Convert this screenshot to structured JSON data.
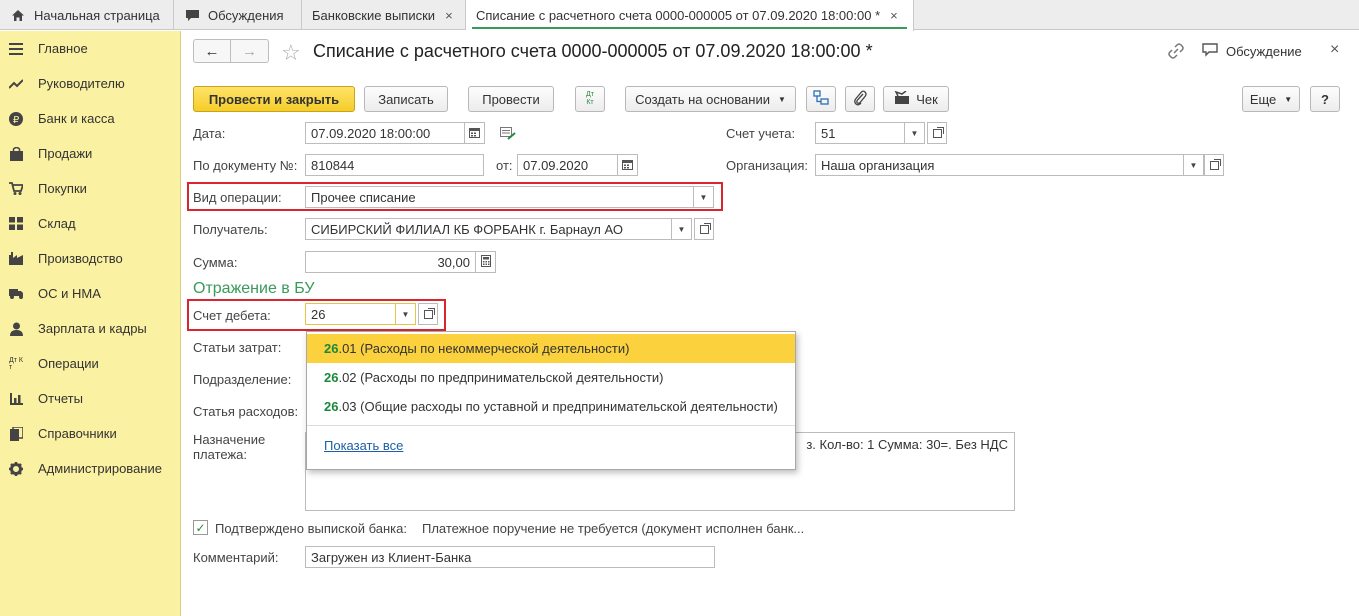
{
  "tabs": [
    {
      "label": "Начальная страница",
      "icon": "home-icon"
    },
    {
      "label": "Обсуждения",
      "icon": "chat-icon"
    },
    {
      "label": "Банковские выписки",
      "close": "×"
    },
    {
      "label": "Списание с расчетного счета 0000-000005 от 07.09.2020 18:00:00 *",
      "close": "×"
    }
  ],
  "sidebar": {
    "items": [
      {
        "label": "Главное",
        "icon": "menu-icon"
      },
      {
        "label": "Руководителю",
        "icon": "trend-icon"
      },
      {
        "label": "Банк и касса",
        "icon": "ruble-icon"
      },
      {
        "label": "Продажи",
        "icon": "bag-icon"
      },
      {
        "label": "Покупки",
        "icon": "cart-icon"
      },
      {
        "label": "Склад",
        "icon": "grid-icon"
      },
      {
        "label": "Производство",
        "icon": "factory-icon"
      },
      {
        "label": "ОС и НМА",
        "icon": "truck-icon"
      },
      {
        "label": "Зарплата и кадры",
        "icon": "person-icon"
      },
      {
        "label": "Операции",
        "icon": "dt-kt-icon",
        "icon_text": "Дт Кт"
      },
      {
        "label": "Отчеты",
        "icon": "bar-chart-icon"
      },
      {
        "label": "Справочники",
        "icon": "books-icon"
      },
      {
        "label": "Администрирование",
        "icon": "gear-icon"
      }
    ]
  },
  "header": {
    "back": "←",
    "forward": "→",
    "star": "☆",
    "title": "Списание с расчетного счета 0000-000005 от 07.09.2020 18:00:00 *",
    "discussion": "Обсуждение",
    "close": "×"
  },
  "toolbar": {
    "post_close": "Провести и закрыть",
    "save": "Записать",
    "post": "Провести",
    "dt_kt": "Дт Кт",
    "create_based": "Создать на основании",
    "receipt": "Чек",
    "more": "Еще",
    "help": "?"
  },
  "form": {
    "date_label": "Дата:",
    "date_value": "07.09.2020 18:00:00",
    "account_label": "Счет учета:",
    "account_value": "51",
    "doc_label": "По документу №:",
    "doc_value": "810844",
    "from_label": "от:",
    "from_value": "07.09.2020",
    "org_label": "Организация:",
    "org_value": "Наша организация",
    "op_label": "Вид операции:",
    "op_value": "Прочее списание",
    "recipient_label": "Получатель:",
    "recipient_value": "СИБИРСКИЙ ФИЛИАЛ КБ ФОРБАНК г. Барнаул АО",
    "sum_label": "Сумма:",
    "sum_value": "30,00",
    "section_title": "Отражение в БУ",
    "debit_label": "Счет дебета:",
    "debit_value": "26",
    "cost_items_label": "Статьи затрат:",
    "division_label": "Подразделение:",
    "expense_label": "Статья расходов:",
    "purpose_label": "Назначение платежа:",
    "purpose_value": "з.  Кол-во: 1 Сумма: 30=. Без НДС",
    "confirmed_label": "Подтверждено выпиской банка:",
    "confirmed_value": "Платежное поручение не требуется (документ исполнен банк...",
    "comment_label": "Комментарий:",
    "comment_value": "Загружен из Клиент-Банка"
  },
  "dropdown": {
    "items": [
      {
        "code": "26",
        "suffix": ".01",
        "text": " (Расходы по некоммерческой деятельности)"
      },
      {
        "code": "26",
        "suffix": ".02",
        "text": " (Расходы по предпринимательской деятельности)"
      },
      {
        "code": "26",
        "suffix": ".03",
        "text": " (Общие расходы по уставной и предпринимательской деятельности)"
      }
    ],
    "show_all": "Показать все"
  }
}
